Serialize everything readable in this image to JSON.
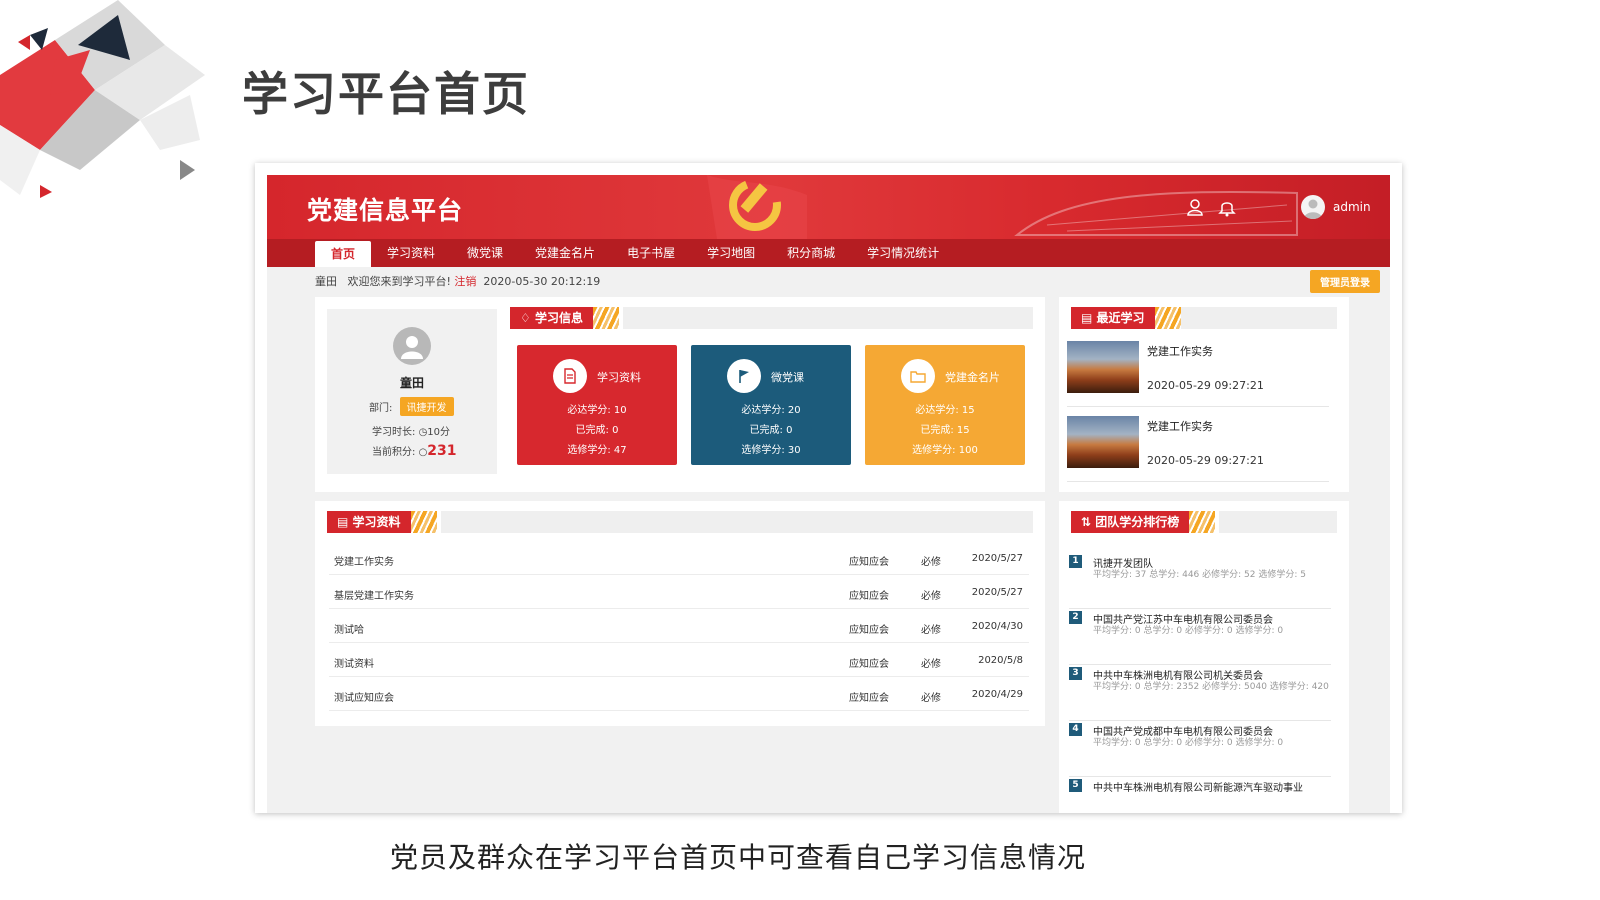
{
  "slide": {
    "title": "学习平台首页",
    "caption": "党员及群众在学习平台首页中可查看自己学习信息情况"
  },
  "header": {
    "app_title": "党建信息平台",
    "user_icon": "user-icon",
    "bell_icon": "bell-icon",
    "admin_name": "admin"
  },
  "nav": {
    "items": [
      "首页",
      "学习资料",
      "微党课",
      "党建金名片",
      "电子书屋",
      "学习地图",
      "积分商城",
      "学习情况统计"
    ]
  },
  "welcome": {
    "user": "童田",
    "greeting": "欢迎您来到学习平台!",
    "logout": "注销",
    "datetime": "2020-05-30 20:12:19",
    "admin_login": "管理员登录"
  },
  "profile": {
    "name": "童田",
    "dept_label": "部门:",
    "dept": "讯捷开发",
    "duration_label": "学习时长:",
    "duration": "10分",
    "points_label": "当前积分:",
    "points": "231"
  },
  "study_info": {
    "heading": "学习信息",
    "cards": [
      {
        "title": "学习资料",
        "required": "必达学分: 10",
        "done": "已完成: 0",
        "elective": "选修学分: 47",
        "color": "#d7282e"
      },
      {
        "title": "微党课",
        "required": "必达学分: 20",
        "done": "已完成: 0",
        "elective": "选修学分: 30",
        "color": "#1c5b7b"
      },
      {
        "title": "党建金名片",
        "required": "必达学分: 15",
        "done": "已完成: 15",
        "elective": "选修学分: 100",
        "color": "#f5a834"
      }
    ]
  },
  "recent": {
    "heading": "最近学习",
    "items": [
      {
        "title": "党建工作实务",
        "time": "2020-05-29 09:27:21"
      },
      {
        "title": "党建工作实务",
        "time": "2020-05-29 09:27:21"
      }
    ]
  },
  "materials": {
    "heading": "学习资料",
    "rows": [
      {
        "name": "党建工作实务",
        "cat": "应知应会",
        "type": "必修",
        "date": "2020/5/27"
      },
      {
        "name": "基层党建工作实务",
        "cat": "应知应会",
        "type": "必修",
        "date": "2020/5/27"
      },
      {
        "name": "测试哈",
        "cat": "应知应会",
        "type": "必修",
        "date": "2020/4/30"
      },
      {
        "name": "测试资料",
        "cat": "应知应会",
        "type": "必修",
        "date": "2020/5/8"
      },
      {
        "name": "测试应知应会",
        "cat": "应知应会",
        "type": "必修",
        "date": "2020/4/29"
      }
    ]
  },
  "ranking": {
    "heading": "团队学分排行榜",
    "items": [
      {
        "rank": "1",
        "name": "讯捷开发团队",
        "detail": "平均学分: 37  总学分: 446  必修学分: 52  选修学分: 5"
      },
      {
        "rank": "2",
        "name": "中国共产党江苏中车电机有限公司委员会",
        "detail": "平均学分: 0  总学分: 0  必修学分: 0  选修学分: 0"
      },
      {
        "rank": "3",
        "name": "中共中车株洲电机有限公司机关委员会",
        "detail": "平均学分: 0  总学分: 2352  必修学分: 5040  选修学分: 420"
      },
      {
        "rank": "4",
        "name": "中国共产党成都中车电机有限公司委员会",
        "detail": "平均学分: 0  总学分: 0  必修学分: 0  选修学分: 0"
      },
      {
        "rank": "5",
        "name": "中共中车株洲电机有限公司新能源汽车驱动事业",
        "detail": ""
      }
    ]
  }
}
